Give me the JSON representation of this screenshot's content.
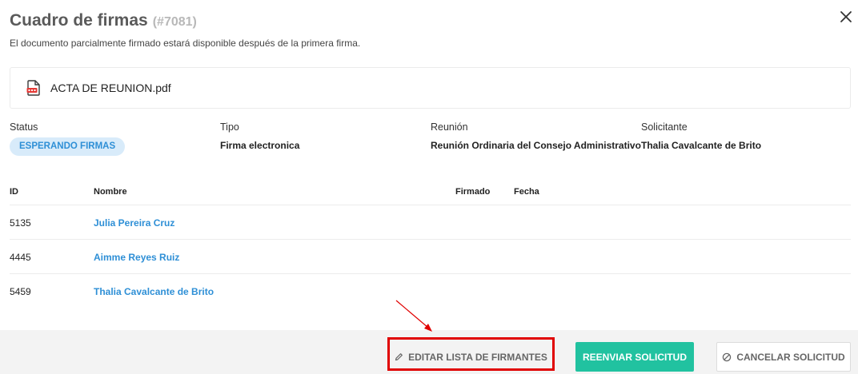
{
  "header": {
    "title": "Cuadro de firmas",
    "request_id": "(#7081)",
    "subtitle": "El documento parcialmente firmado estará disponible después de la primera firma.",
    "close_icon": "close-icon"
  },
  "file": {
    "icon": "pdf-file-icon",
    "name": "ACTA DE REUNION.pdf"
  },
  "meta": {
    "status_label": "Status",
    "status_value": "ESPERANDO FIRMAS",
    "type_label": "Tipo",
    "type_value": "Firma electronica",
    "meeting_label": "Reunión",
    "meeting_value": "Reunión Ordinaria del Consejo Administrativo",
    "requester_label": "Solicitante",
    "requester_value": "Thalia Cavalcante de Brito"
  },
  "table": {
    "headers": {
      "id": "ID",
      "name": "Nombre",
      "signed": "Firmado",
      "date": "Fecha"
    },
    "rows": [
      {
        "id": "5135",
        "name": "Julia Pereira Cruz"
      },
      {
        "id": "4445",
        "name": "Aimme Reyes Ruiz"
      },
      {
        "id": "5459",
        "name": "Thalia Cavalcante de Brito"
      }
    ]
  },
  "footer": {
    "edit_label": "EDITAR LISTA DE FIRMANTES",
    "resend_label": "REENVIAR SOLICITUD",
    "cancel_label": "CANCELAR SOLICITUD"
  },
  "colors": {
    "accent_link": "#2e8fd6",
    "badge_bg": "#d8ebfa",
    "resend_bg": "#21c2a0",
    "highlight": "#e00000"
  }
}
